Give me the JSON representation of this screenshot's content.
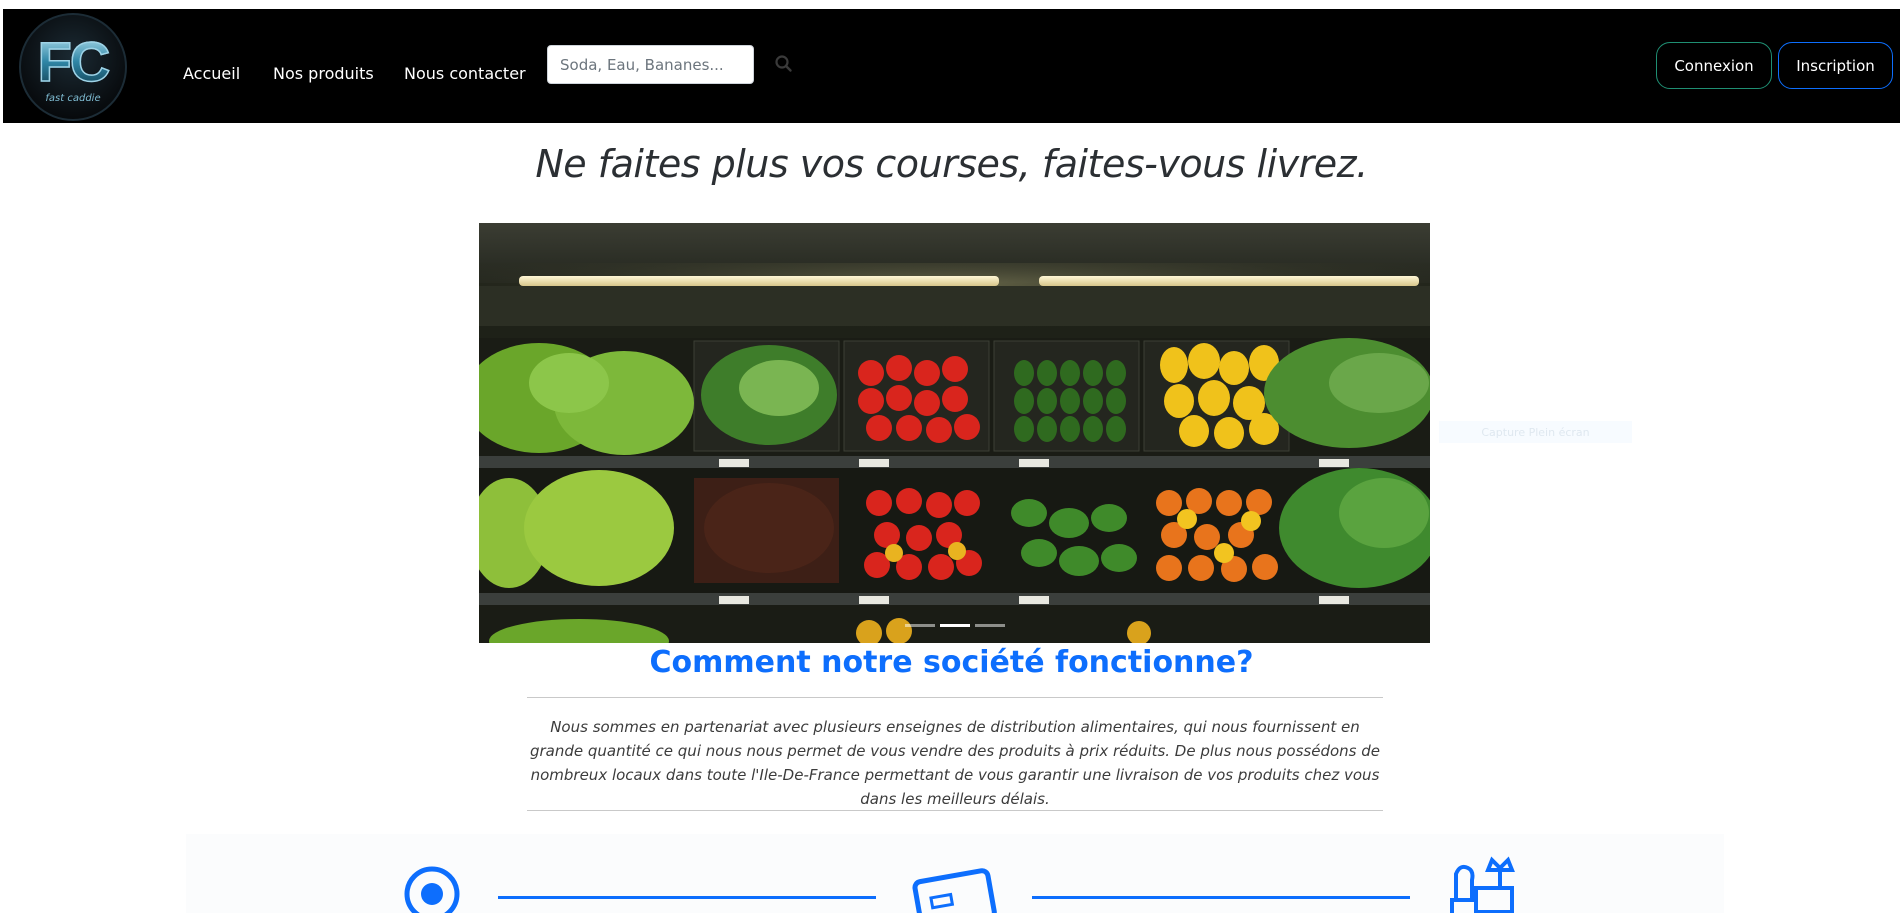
{
  "logo": {
    "letters": "FC",
    "subtitle": "fast caddie"
  },
  "nav": {
    "links": [
      "Accueil",
      "Nos produits",
      "Nous contacter"
    ],
    "search_placeholder": "Soda, Eau, Bananes...",
    "login_label": "Connexion",
    "signup_label": "Inscription"
  },
  "hero": {
    "title": "Ne faites plus vos courses, faites-vous livrez."
  },
  "carousel": {
    "image_alt": "Rayon de fruits et légumes",
    "indicators": 3,
    "active_indicator": 2
  },
  "overlay": {
    "label": "Capture Plein écran"
  },
  "about": {
    "title": "Comment notre société fonctionne?",
    "description": "Nous sommes en partenariat avec plusieurs enseignes de distribution alimentaires, qui nous fournissent en grande quantité ce qui nous nous permet de vous vendre des produits à prix réduits. De plus nous possédons de nombreux locaux dans toute l'Ile-De-France permettant de vous garantir une livraison de vos produits chez vous dans les meilleurs délais."
  },
  "steps": {
    "icons": [
      "location-pin-icon",
      "credit-card-icon",
      "delivery-store-icon"
    ]
  },
  "colors": {
    "accent": "#0d6efd",
    "nav_bg": "#000000",
    "login_border": "#1f8f73",
    "signup_border": "#0d6efd"
  }
}
